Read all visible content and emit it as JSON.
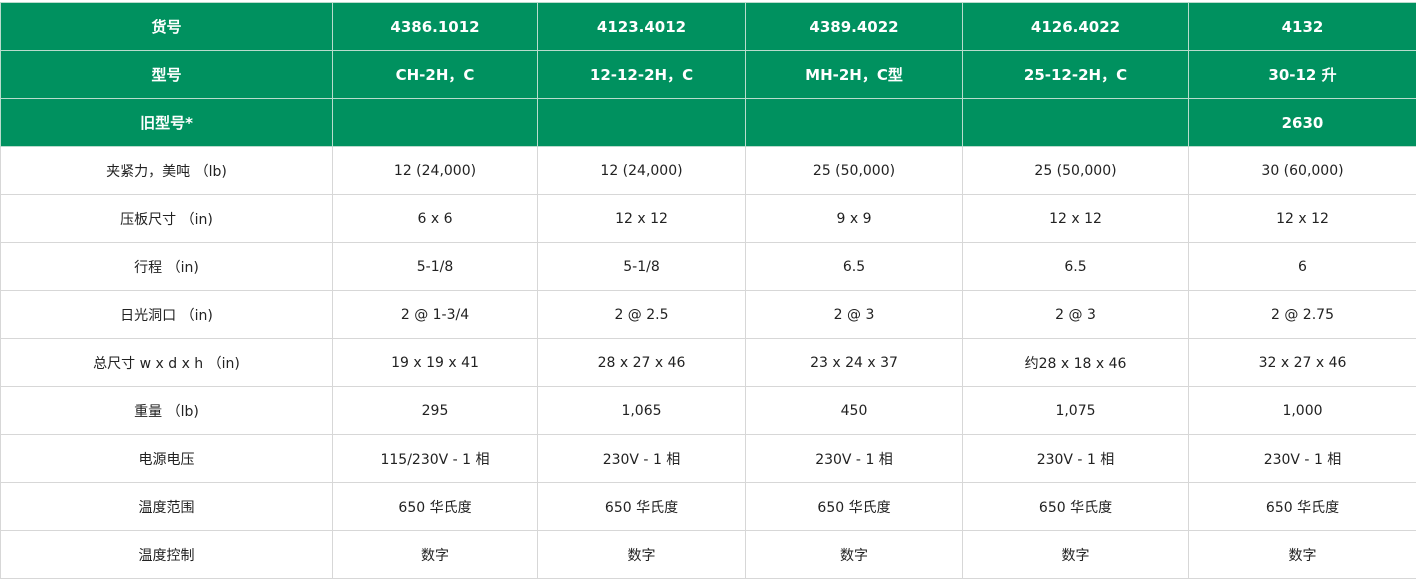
{
  "table": {
    "header_rows": [
      {
        "label": "货号",
        "cells": [
          "4386.1012",
          "4123.4012",
          "4389.4022",
          "4126.4022",
          "4132"
        ]
      },
      {
        "label": "型号",
        "cells": [
          "CH-2H，C",
          "12-12-2H，C",
          "MH-2H，C型",
          "25-12-2H，C",
          "30-12 升"
        ]
      },
      {
        "label": "旧型号*",
        "cells": [
          "",
          "",
          "",
          "",
          "2630"
        ]
      }
    ],
    "body_rows": [
      {
        "label": "夹紧力，美吨 （lb)",
        "cells": [
          "12 (24,000)",
          "12 (24,000)",
          "25 (50,000)",
          "25 (50,000)",
          "30 (60,000)"
        ]
      },
      {
        "label": "压板尺寸 （in)",
        "cells": [
          "6 x 6",
          "12 x 12",
          "9 x 9",
          "12 x 12",
          "12 x 12"
        ]
      },
      {
        "label": "行程 （in)",
        "cells": [
          "5-1/8",
          "5-1/8",
          "6.5",
          "6.5",
          "6"
        ]
      },
      {
        "label": "日光洞口 （in)",
        "cells": [
          "2 @ 1-3/4",
          "2 @ 2.5",
          "2 @ 3",
          "2 @ 3",
          "2 @ 2.75"
        ]
      },
      {
        "label": "总尺寸 w x d x h （in)",
        "cells": [
          "19 x 19 x 41",
          "28 x 27 x 46",
          "23 x 24 x 37",
          "约28 x 18 x 46",
          "32 x 27 x 46"
        ]
      },
      {
        "label": "重量 （lb)",
        "cells": [
          "295",
          "1,065",
          "450",
          "1,075",
          "1,000"
        ]
      },
      {
        "label": "电源电压",
        "cells": [
          "115/230V - 1 相",
          "230V - 1 相",
          "230V - 1 相",
          "230V - 1 相",
          "230V - 1 相"
        ]
      },
      {
        "label": "温度范围",
        "cells": [
          "650 华氏度",
          "650 华氏度",
          "650 华氏度",
          "650 华氏度",
          "650 华氏度"
        ]
      },
      {
        "label": "温度控制",
        "cells": [
          "数字",
          "数字",
          "数字",
          "数字",
          "数字"
        ]
      }
    ],
    "colors": {
      "header_bg": "#00915f",
      "header_text": "#ffffff",
      "body_text": "#222222",
      "border": "#d7d7d7"
    }
  }
}
